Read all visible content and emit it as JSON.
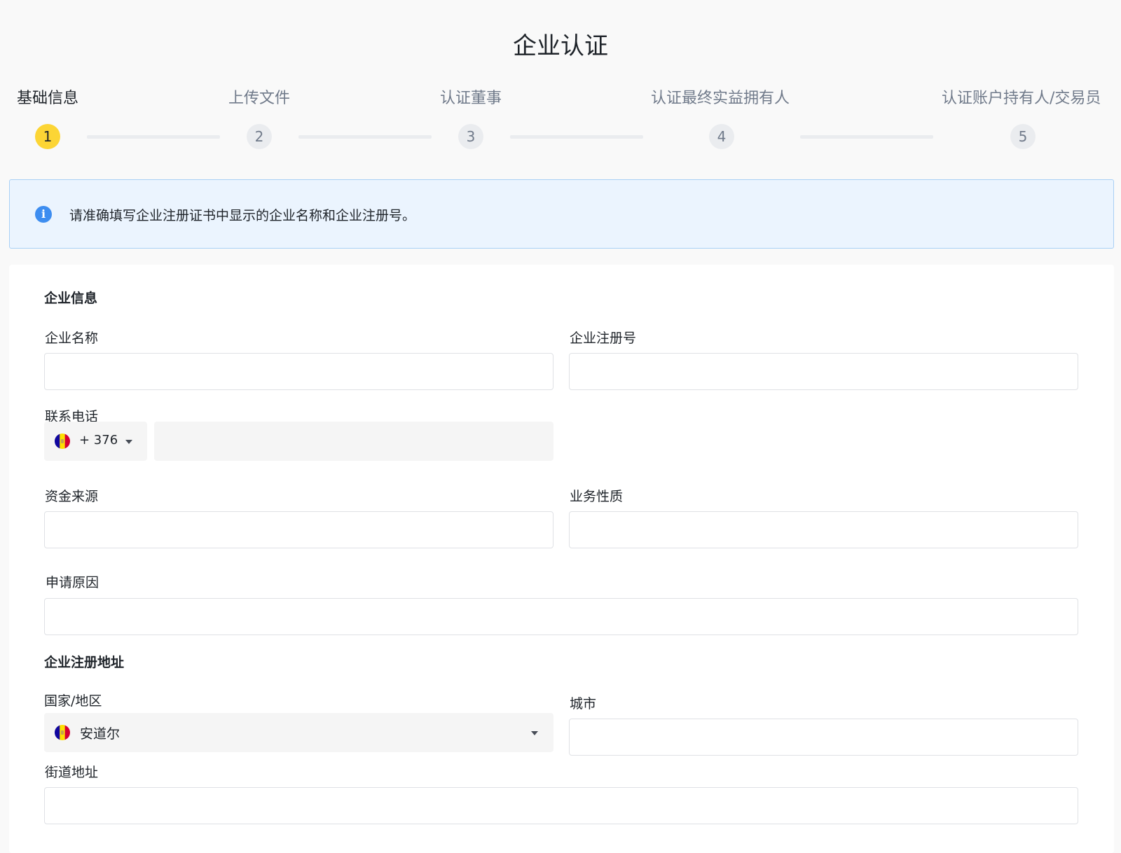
{
  "page": {
    "title": "企业认证"
  },
  "steps": [
    {
      "number": "1",
      "label": "基础信息",
      "active": true
    },
    {
      "number": "2",
      "label": "上传文件",
      "active": false
    },
    {
      "number": "3",
      "label": "认证董事",
      "active": false
    },
    {
      "number": "4",
      "label": "认证最终实益拥有人",
      "active": false
    },
    {
      "number": "5",
      "label": "认证账户持有人/交易员",
      "active": false
    }
  ],
  "notice": {
    "icon": "info-icon",
    "text": "请准确填写企业注册证书中显示的企业名称和企业注册号。"
  },
  "company_info": {
    "section_title": "企业信息",
    "company_name": {
      "label": "企业名称",
      "value": ""
    },
    "registration_number": {
      "label": "企业注册号",
      "value": ""
    },
    "phone": {
      "label": "联系电话",
      "country_flag": "andorra-flag-icon",
      "dial_code": "+ 376",
      "value": ""
    },
    "source_of_funds": {
      "label": "资金来源",
      "value": ""
    },
    "business_nature": {
      "label": "业务性质",
      "value": ""
    },
    "application_reason": {
      "label": "申请原因",
      "value": ""
    }
  },
  "registered_address": {
    "section_title": "企业注册地址",
    "country": {
      "label": "国家/地区",
      "country_flag": "andorra-flag-icon",
      "value": "安道尔"
    },
    "city": {
      "label": "城市",
      "value": ""
    },
    "street": {
      "label": "街道地址",
      "value": ""
    }
  },
  "colors": {
    "accent_yellow": "#fcd535",
    "notice_bg": "#ebf4fe",
    "notice_border": "#a9d0f5",
    "info_blue": "#3d8df0",
    "text_primary": "#1e2329",
    "text_secondary": "#707a8a"
  }
}
